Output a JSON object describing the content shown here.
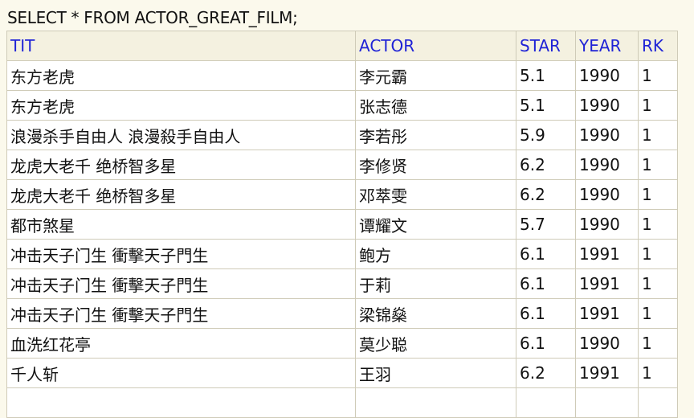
{
  "query": "SELECT * FROM ACTOR_GREAT_FILM;",
  "table": {
    "columns": [
      "TIT",
      "ACTOR",
      "STAR",
      "YEAR",
      "RK"
    ],
    "rows": [
      [
        "东方老虎",
        "李元霸",
        "5.1",
        "1990",
        "1"
      ],
      [
        "东方老虎",
        "张志德",
        "5.1",
        "1990",
        "1"
      ],
      [
        "浪漫杀手自由人 浪漫殺手自由人",
        "李若彤",
        "5.9",
        "1990",
        "1"
      ],
      [
        "龙虎大老千 绝桥智多星",
        "李修贤",
        "6.2",
        "1990",
        "1"
      ],
      [
        "龙虎大老千 绝桥智多星",
        "邓萃雯",
        "6.2",
        "1990",
        "1"
      ],
      [
        "都市煞星",
        "谭耀文",
        "5.7",
        "1990",
        "1"
      ],
      [
        "冲击天子门生 衝擊天子門生",
        "鲍方",
        "6.1",
        "1991",
        "1"
      ],
      [
        "冲击天子门生 衝擊天子門生",
        "于莉",
        "6.1",
        "1991",
        "1"
      ],
      [
        "冲击天子门生 衝擊天子門生",
        "梁锦燊",
        "6.1",
        "1991",
        "1"
      ],
      [
        "血洗红花亭",
        "莫少聪",
        "6.1",
        "1990",
        "1"
      ],
      [
        "千人斩",
        "王羽",
        "6.2",
        "1991",
        "1"
      ],
      [
        "",
        "",
        "",
        "",
        ""
      ]
    ]
  }
}
